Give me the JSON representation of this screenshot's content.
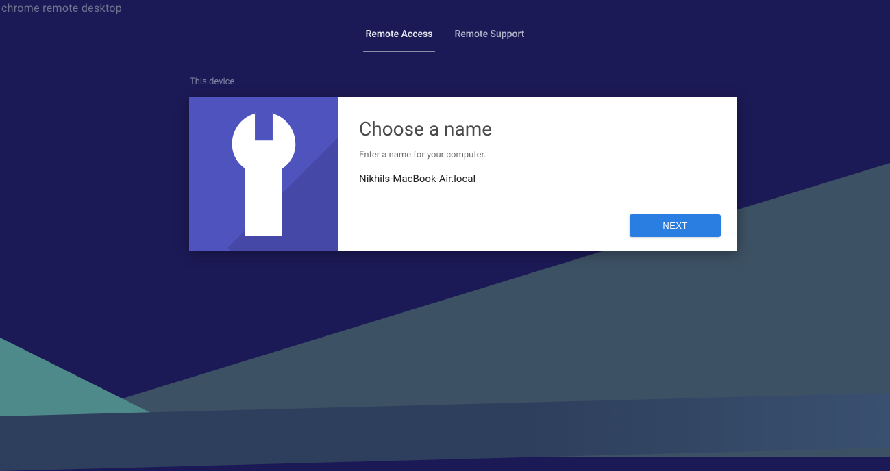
{
  "header": {
    "app_title": "chrome remote desktop"
  },
  "tabs": {
    "remote_access": "Remote Access",
    "remote_support": "Remote Support"
  },
  "section": {
    "label": "This device"
  },
  "card": {
    "title": "Choose a name",
    "subtitle": "Enter a name for your computer.",
    "input_value": "Nikhils-MacBook-Air.local",
    "next_label": "NEXT"
  }
}
